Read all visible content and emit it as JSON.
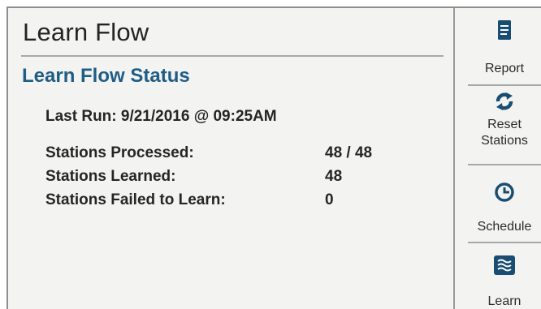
{
  "header": {
    "title": "Learn Flow"
  },
  "section": {
    "title": "Learn Flow Status"
  },
  "last_run": "Last Run: 9/21/2016 @ 09:25AM",
  "stats": [
    {
      "label": "Stations Processed:",
      "value": "48 / 48"
    },
    {
      "label": "Stations Learned:",
      "value": "48"
    },
    {
      "label": "Stations Failed to Learn:",
      "value": "0"
    }
  ],
  "sidebar": {
    "report_label": "Report",
    "reset_label_line1": "Reset",
    "reset_label_line2": "Stations",
    "schedule_label": "Schedule",
    "learn_label": "Learn"
  },
  "colors": {
    "accent": "#1f5d86",
    "icon": "#1a4d72",
    "background": "#f3f3f1"
  }
}
